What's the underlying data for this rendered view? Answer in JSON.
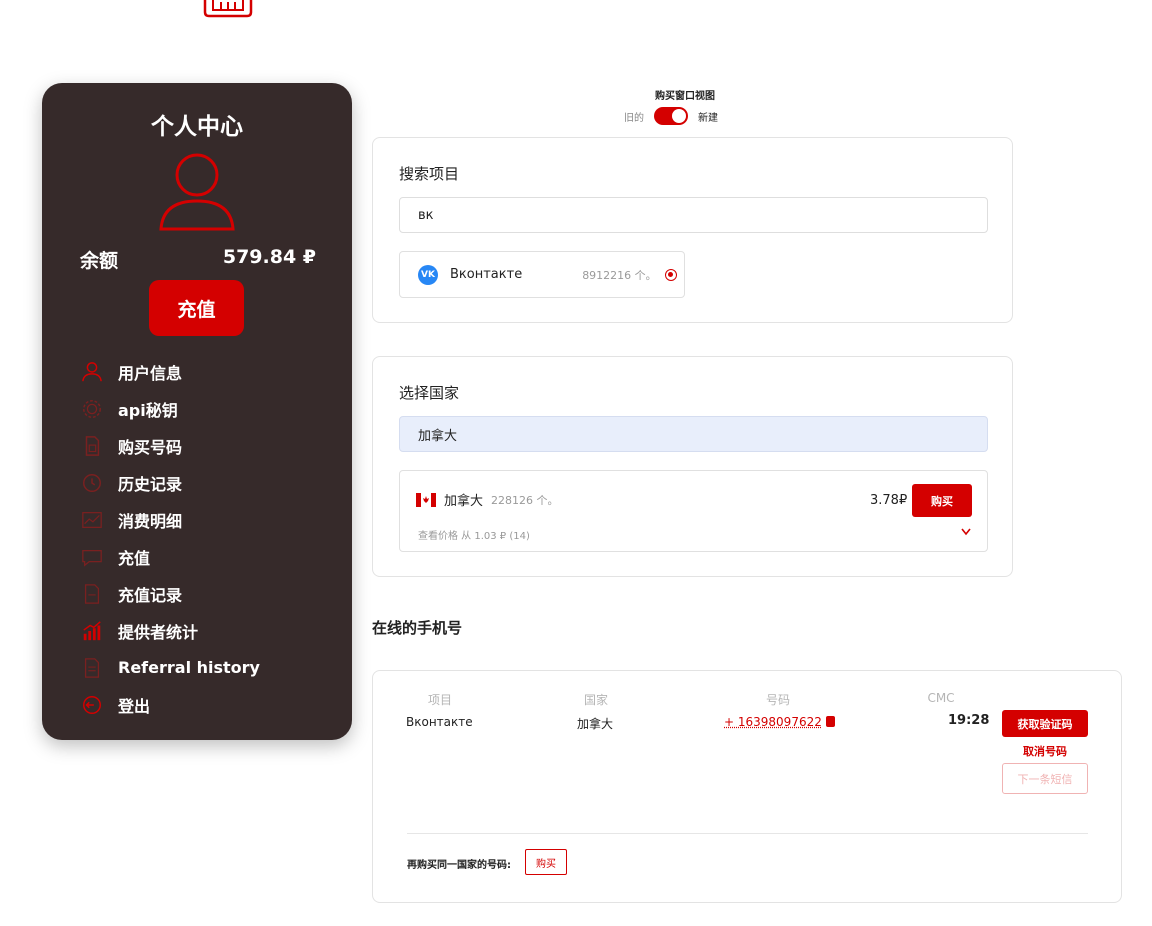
{
  "colors": {
    "accent": "#d40000",
    "sidebar_bg": "#362a2a",
    "vk_blue": "#2787f5"
  },
  "sidebar": {
    "title": "个人中心",
    "balance_label": "余额",
    "balance_value": "579.84 ₽",
    "recharge_button": "充值",
    "menu": [
      {
        "label": "用户信息",
        "icon": "user-icon"
      },
      {
        "label": "api秘钥",
        "icon": "api-icon"
      },
      {
        "label": "购买号码",
        "icon": "sim-card-icon"
      },
      {
        "label": "历史记录",
        "icon": "history-icon"
      },
      {
        "label": "消费明细",
        "icon": "chart-icon"
      },
      {
        "label": "充值",
        "icon": "wallet-icon"
      },
      {
        "label": "充值记录",
        "icon": "receipt-icon"
      },
      {
        "label": "提供者统计",
        "icon": "stats-icon"
      },
      {
        "label": "Referral history",
        "icon": "document-icon"
      },
      {
        "label": "登出",
        "icon": "logout-icon"
      }
    ]
  },
  "view": {
    "title": "购买窗口视图",
    "old_label": "旧的",
    "new_label": "新建"
  },
  "search": {
    "heading": "搜索项目",
    "value": "вк",
    "result": {
      "name": "Вконтакте",
      "count": "8912216 个。",
      "icon": "vk-logo"
    }
  },
  "country": {
    "heading": "选择国家",
    "value": "加拿大",
    "result": {
      "name": "加拿大",
      "count": "228126 个。",
      "price": "3.78₽",
      "buy_label": "购买",
      "price_hint": "查看价格 从 1.03 ₽ (14)",
      "icon": "canada-flag-icon"
    }
  },
  "online": {
    "heading": "在线的手机号",
    "columns": [
      "项目",
      "国家",
      "号码",
      "СМС"
    ],
    "row": {
      "service": "Вконтакте",
      "country": "加拿大",
      "phone": "+ 16398097622",
      "sms": "19:28"
    },
    "get_code_label": "获取验证码",
    "cancel_label": "取消号码",
    "next_sms_label": "下一条短信",
    "rebuy_label": "再购买同一国家的号码:",
    "rebuy_button": "购买"
  }
}
